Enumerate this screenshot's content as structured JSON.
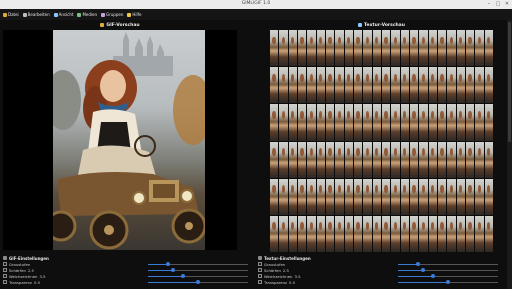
{
  "window": {
    "title": "GIMLIGIF 1.0"
  },
  "menubar": {
    "items": [
      {
        "label": "Datei",
        "icon": "folder-icon",
        "color": "#e0a93a"
      },
      {
        "label": "Bearbeiten",
        "icon": "pencil-icon",
        "color": "#bdbdbd"
      },
      {
        "label": "Ansicht",
        "icon": "eye-icon",
        "color": "#8ec5ff"
      },
      {
        "label": "Medien",
        "icon": "image-icon",
        "color": "#79c27b"
      },
      {
        "label": "Gruppen",
        "icon": "group-icon",
        "color": "#c9a0dc"
      },
      {
        "label": "Hilfe",
        "icon": "help-icon",
        "color": "#f0c84a"
      }
    ]
  },
  "gif_panel": {
    "title": "GIF-Vorschau",
    "icon": "film-icon",
    "icon_color": "#e0a93a"
  },
  "texture_panel": {
    "title": "Textur-Vorschau",
    "icon": "grid-icon",
    "icon_color": "#8ec5ff",
    "columns": 24,
    "rows": 6
  },
  "gif_settings": {
    "title": "GIF-Einstellungen",
    "icon": "settings-icon",
    "rows": [
      {
        "label": "Graustufen",
        "value": "",
        "checked": false,
        "level": 0.2
      },
      {
        "label": "Schärfen",
        "value": "2.5",
        "checked": false,
        "level": 0.25
      },
      {
        "label": "Weichzeichnen",
        "value": "3.5",
        "checked": false,
        "level": 0.35
      },
      {
        "label": "Transparenz",
        "value": "0.5",
        "checked": false,
        "level": 0.5
      }
    ]
  },
  "texture_settings": {
    "title": "Textur-Einstellungen",
    "icon": "settings-icon",
    "rows": [
      {
        "label": "Graustufen",
        "value": "",
        "checked": false,
        "level": 0.2
      },
      {
        "label": "Schärfen",
        "value": "2.5",
        "checked": false,
        "level": 0.25
      },
      {
        "label": "Weichzeichnen",
        "value": "3.5",
        "checked": false,
        "level": 0.35
      },
      {
        "label": "Transparenz",
        "value": "0.5",
        "checked": false,
        "level": 0.5
      }
    ]
  },
  "colors": {
    "accent": "#3a7bd5",
    "background": "#0e0e0e",
    "menubar": "#151515"
  }
}
